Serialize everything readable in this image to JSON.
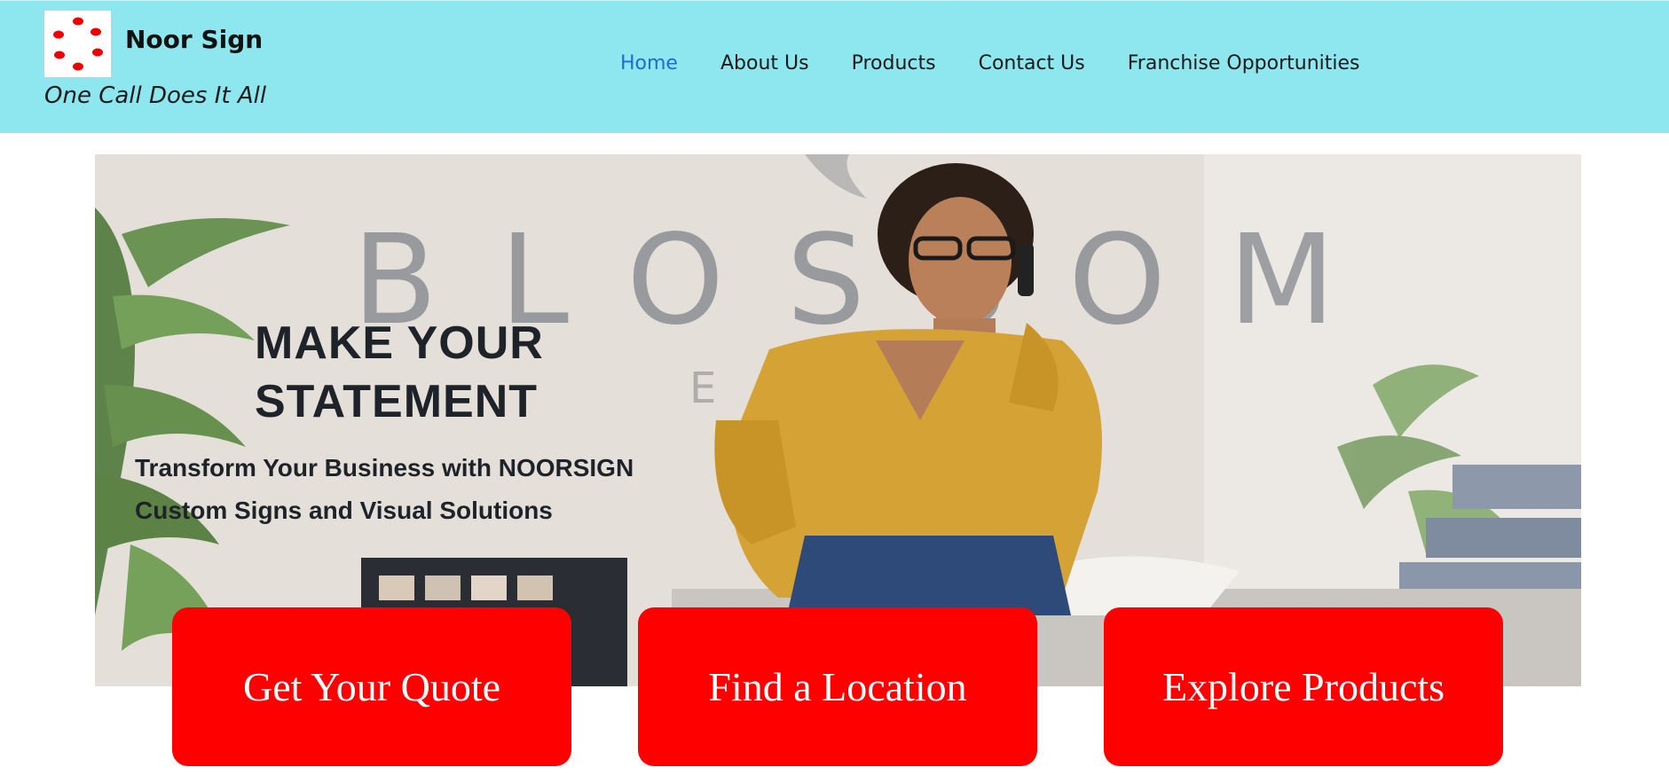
{
  "header": {
    "brand_name": "Noor Sign",
    "tagline": "One Call Does It All",
    "logo_icon": "red-dot-ring-icon",
    "background_color": "#8ee6ee"
  },
  "nav": {
    "items": [
      {
        "label": "Home",
        "active": true
      },
      {
        "label": "About Us",
        "active": false
      },
      {
        "label": "Products",
        "active": false
      },
      {
        "label": "Contact Us",
        "active": false
      },
      {
        "label": "Franchise Opportunities",
        "active": false
      }
    ],
    "active_color": "#1a6fd0"
  },
  "hero": {
    "title_line1": "MAKE YOUR",
    "title_line2": "STATEMENT",
    "subtitle_line1": "Transform Your Business with NOORSIGN",
    "subtitle_line2": "Custom Signs and Visual Solutions",
    "wall_sign_text": "BLOSSOM"
  },
  "cta": {
    "quote_label": "Get Your Quote",
    "location_label": "Find a Location",
    "products_label": "Explore Products",
    "color": "#ff0000"
  }
}
